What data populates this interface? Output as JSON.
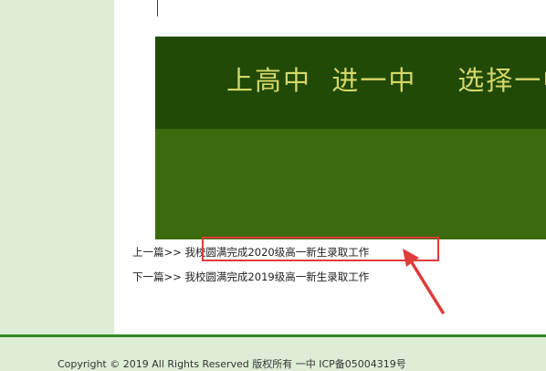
{
  "banner": {
    "slogan": "上高中  进一中    选择一中"
  },
  "navigation": {
    "prev": {
      "prefix": "上一篇>>",
      "title": "我校圆满完成2020级高一新生录取工作"
    },
    "next": {
      "prefix": "下一篇>>",
      "title": "我校圆满完成2019级高一新生录取工作"
    }
  },
  "footer": {
    "copyright": "Copyright © 2019 All Rights Reserved 版权所有 一中 ICP备05004319号"
  },
  "colors": {
    "annotation": "#e03c3c",
    "footer_accent": "#2f8a23",
    "banner_dark": "#214a07",
    "banner_light": "#3c6a0f"
  }
}
